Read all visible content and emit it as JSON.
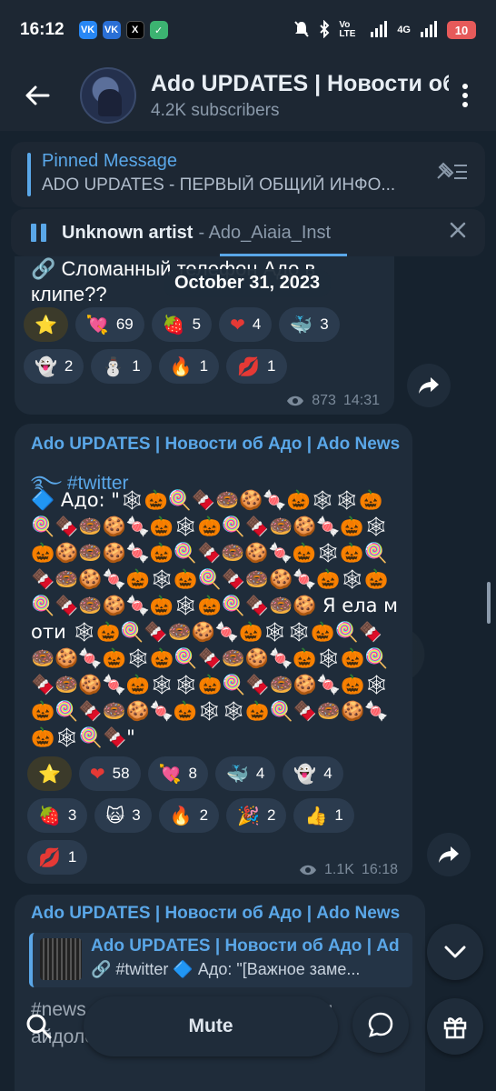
{
  "status_bar": {
    "time": "16:12",
    "apps": [
      "VK",
      "VK",
      "X",
      "✓"
    ],
    "network": "4G",
    "volte": "Vo LTE",
    "battery": "10"
  },
  "header": {
    "title": "Ado UPDATES | Новости об Адо | Ado News",
    "subscribers": "4.2K subscribers"
  },
  "pinned": {
    "label": "Pinned Message",
    "text": "ADO UPDATES - ПЕРВЫЙ ОБЩИЙ ИНФО..."
  },
  "player": {
    "artist": "Unknown artist",
    "track": "- Ado_Aiaia_Inst"
  },
  "message1": {
    "text": "🔗 Сломанный телефон Адо в клипе??",
    "date": "October 31, 2023",
    "reactions": [
      {
        "emoji": "⭐",
        "count": ""
      },
      {
        "emoji": "💘",
        "count": "69"
      },
      {
        "emoji": "🍓",
        "count": "5"
      },
      {
        "emoji": "❤",
        "count": "4"
      },
      {
        "emoji": "🐳",
        "count": "3"
      },
      {
        "emoji": "👻",
        "count": "2"
      },
      {
        "emoji": "⛄",
        "count": "1"
      },
      {
        "emoji": "🔥",
        "count": "1"
      },
      {
        "emoji": "💋",
        "count": "1"
      }
    ],
    "views": "873",
    "time": "14:31"
  },
  "message2": {
    "author": "Ado UPDATES | Новости об Адо | Ado News",
    "tag": "#twitter",
    "body": "🔷 Адо: \"🕸🎃🍭🍫🍩🍪🍬🎃🕸🕸🎃🍭🍫🍩🍪🍬🎃🕸🎃🍭🍫🍩🍪🍬🎃🕸🎃🍪🍩🍪🍬🎃🍭🍫🍩🍪🍬🎃🕸🎃🍭🍫🍩🍪🍬🎃🕸🎃🍭🍫🍩🍪🍬🎃🕸🎃🍭🍫🍩🍪🍬🎃🕸🎃🍭🍫🍩🍪 Я ела моти 🕸🎃🍭🍫🍩🍪🍬🎃🕸🕸🎃🍭🍫🍩🍪🍬🎃🕸🎃🍭🍫🍩🍪🍬🎃🕸🎃🍭🍫🍩🍪🍬🎃🕸🕸🎃🍭🍫🍩🍪🍬🎃🕸🎃🍭🍫🍩🍪🍬🎃🕸🕸🎃🍭🍫🍩🍪🍬🎃🕸🍭🍫\"",
    "reactions": [
      {
        "emoji": "⭐",
        "count": ""
      },
      {
        "emoji": "❤",
        "count": "58"
      },
      {
        "emoji": "💘",
        "count": "8"
      },
      {
        "emoji": "🐳",
        "count": "4"
      },
      {
        "emoji": "👻",
        "count": "4"
      },
      {
        "emoji": "🍓",
        "count": "3"
      },
      {
        "emoji": "🙀",
        "count": "3"
      },
      {
        "emoji": "🔥",
        "count": "2"
      },
      {
        "emoji": "🎉",
        "count": "2"
      },
      {
        "emoji": "👍",
        "count": "1"
      },
      {
        "emoji": "💋",
        "count": "1"
      }
    ],
    "views": "1.1K",
    "time": "16:18"
  },
  "message3": {
    "author": "Ado UPDATES | Новости об Адо | Ado News",
    "reply_title": "Ado UPDATES | Новости об Адо | Ado News",
    "reply_text": "🔗 #twitter 🔷 Адо: \"[Важное заме...",
    "body": "#news ... Адо ... принимает заявки айдолов, она принимает заявки"
  },
  "bottom": {
    "mute_label": "Mute"
  }
}
